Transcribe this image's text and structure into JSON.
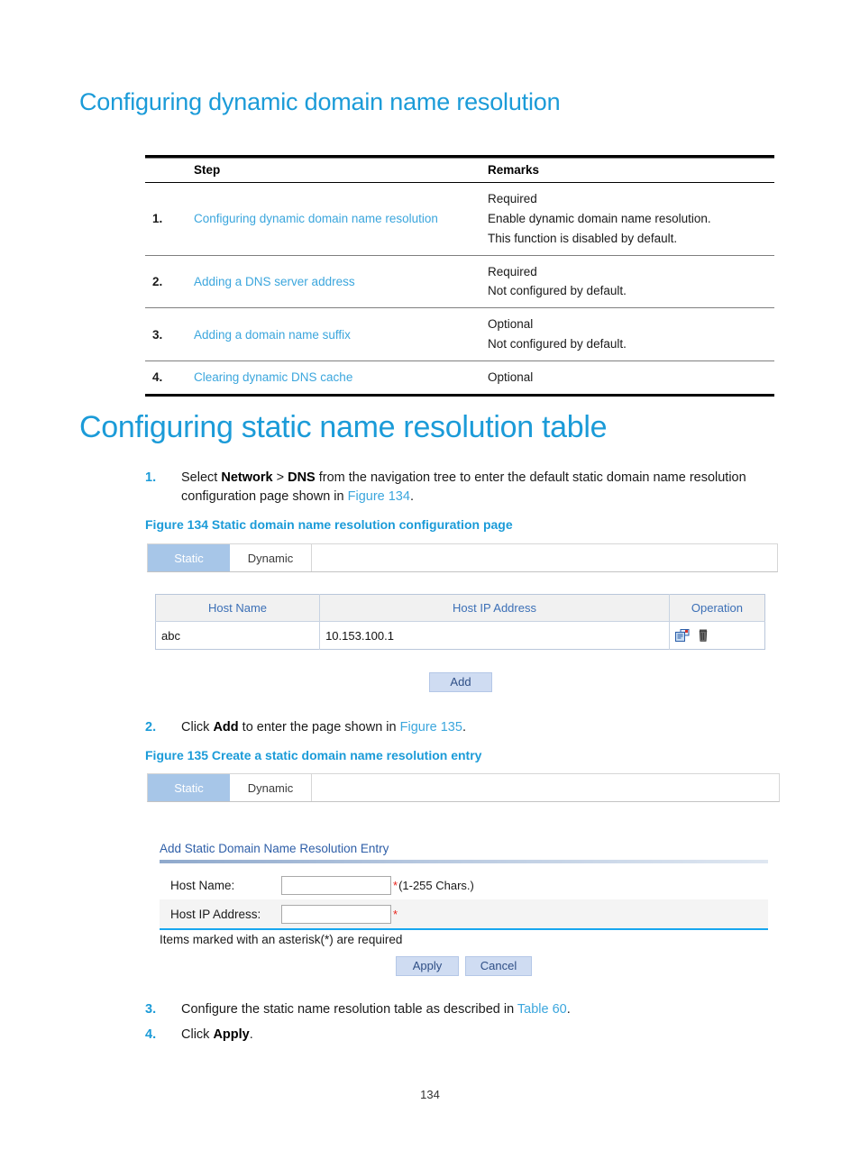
{
  "document": {
    "page_number": "134",
    "section_heading": "Configuring dynamic domain name resolution",
    "section_heading_2": "Configuring static name resolution table"
  },
  "step_table": {
    "headers": {
      "step": "Step",
      "remarks": "Remarks"
    },
    "rows": [
      {
        "num": "1.",
        "step": "Configuring dynamic domain name resolution",
        "remarks": [
          "Required",
          "Enable dynamic domain name resolution.",
          "This function is disabled by default."
        ]
      },
      {
        "num": "2.",
        "step": "Adding a DNS server address",
        "remarks": [
          "Required",
          "Not configured by default."
        ]
      },
      {
        "num": "3.",
        "step": "Adding a domain name suffix",
        "remarks": [
          "Optional",
          "Not configured by default."
        ]
      },
      {
        "num": "4.",
        "step": "Clearing dynamic DNS cache",
        "remarks": [
          "Optional"
        ]
      }
    ]
  },
  "steps": {
    "one": {
      "num": "1.",
      "pre": "Select ",
      "bold1": "Network",
      "mid1": " > ",
      "bold2": "DNS",
      "mid2": " from the navigation tree to enter the default static domain name resolution configuration page shown in ",
      "xref": "Figure 134",
      "post": "."
    },
    "two": {
      "num": "2.",
      "pre": "Click ",
      "bold1": "Add",
      "mid1": " to enter the page shown in ",
      "xref": "Figure 135",
      "post": "."
    },
    "three": {
      "num": "3.",
      "pre": "Configure the static name resolution table as described in ",
      "xref": "Table 60",
      "post": "."
    },
    "four": {
      "num": "4.",
      "pre": "Click ",
      "bold1": "Apply",
      "post": "."
    }
  },
  "figures": {
    "fig134": {
      "caption": "Figure 134 Static domain name resolution configuration page",
      "tabs": [
        {
          "label": "Static",
          "active": true
        },
        {
          "label": "Dynamic",
          "active": false
        }
      ],
      "grid": {
        "headers": [
          "Host Name",
          "Host IP Address",
          "Operation"
        ],
        "rows": [
          {
            "host_name": "abc",
            "host_ip": "10.153.100.1",
            "operation_icons": [
              "edit-icon",
              "delete-icon"
            ]
          }
        ]
      },
      "add_button": "Add"
    },
    "fig135": {
      "caption": "Figure 135 Create a static domain name resolution entry",
      "tabs": [
        {
          "label": "Static",
          "active": true
        },
        {
          "label": "Dynamic",
          "active": false
        }
      ],
      "form_title": "Add Static Domain Name Resolution Entry",
      "fields": [
        {
          "label": "Host Name:",
          "value": "",
          "required_mark": "*",
          "hint": "(1-255 Chars.)"
        },
        {
          "label": "Host IP Address:",
          "value": "",
          "required_mark": "*",
          "hint": ""
        }
      ],
      "required_note": "Items marked with an asterisk(*) are required",
      "buttons": {
        "apply": "Apply",
        "cancel": "Cancel"
      }
    }
  },
  "colors": {
    "heading_blue": "#1b9bd8",
    "link_blue": "#3ba6dd",
    "tab_active_bg": "#a7c6e8",
    "grid_header_text": "#3b6fb6",
    "button_bg": "#cfdcf2",
    "asterisk_red": "#e8231b",
    "cyan_rule": "#17a7ef"
  }
}
